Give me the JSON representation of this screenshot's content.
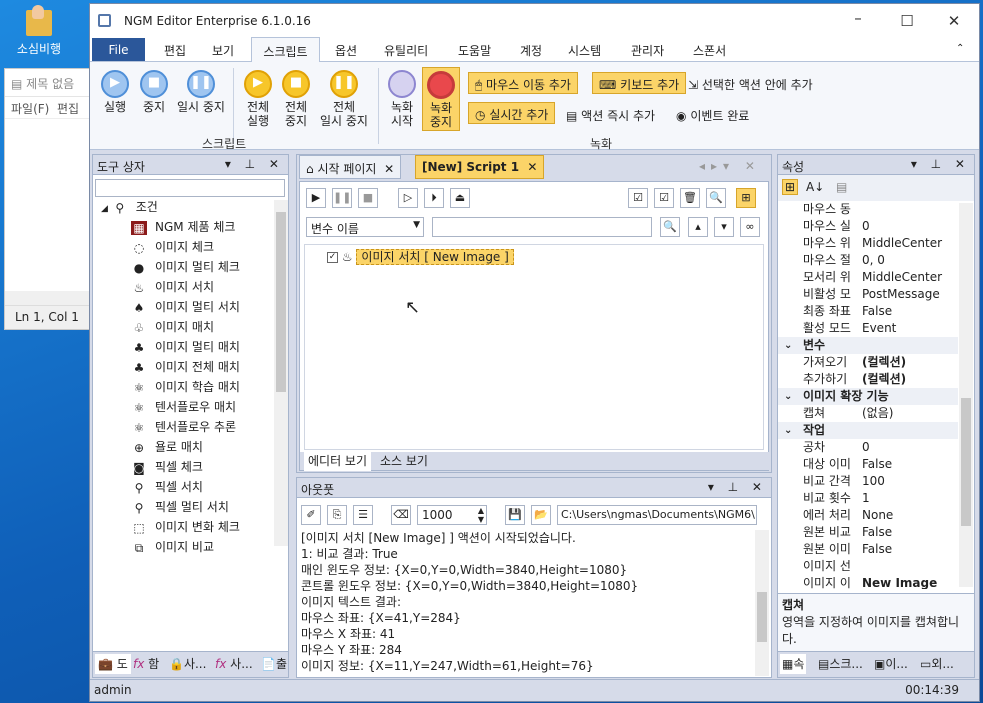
{
  "desktop": {
    "icon_label": "소심비행"
  },
  "bg_window": {
    "title": "제목 없음",
    "menu_file": "파일(F)",
    "menu_edit": "편집",
    "status": "Ln 1, Col 1"
  },
  "app": {
    "title": "NGM Editor   Enterprise 6.1.0.16",
    "menus": [
      "File",
      "편집",
      "보기",
      "스크립트",
      "옵션",
      "유틸리티",
      "도움말",
      "계정",
      "시스템",
      "관리자",
      "스폰서"
    ],
    "ribbon": {
      "run": "실행",
      "stop": "중지",
      "pause": "일시 중지",
      "run_all": [
        "전체",
        "실행"
      ],
      "stop_all": [
        "전체",
        "중지"
      ],
      "pause_all": [
        "전체",
        "일시 중지"
      ],
      "rec_start": [
        "녹화",
        "시작"
      ],
      "rec_stop": [
        "녹화",
        "중지"
      ],
      "add_mouse": "마우스 이동 추가",
      "add_key": "키보드 추가",
      "add_in_selected": "선택한 액션 안에 추가",
      "add_realtime": "실시간 추가",
      "add_action_now": "액션 즉시 추가",
      "event_done": "이벤트 완료",
      "group_script": "스크립트",
      "group_record": "녹화"
    },
    "toolbox": {
      "title": "도구 상자",
      "root": "조건",
      "items": [
        {
          "label": "NGM 제품 체크",
          "icon": "ngm-icon"
        },
        {
          "label": "이미지 체크",
          "icon": "drop-outline-icon"
        },
        {
          "label": "이미지 멀티 체크",
          "icon": "drop-filled-icon"
        },
        {
          "label": "이미지 서치",
          "icon": "flame-outline-icon"
        },
        {
          "label": "이미지 멀티 서치",
          "icon": "flame-filled-icon"
        },
        {
          "label": "이미지 매치",
          "icon": "flames-outline-icon"
        },
        {
          "label": "이미지 멀티 매치",
          "icon": "flames-filled-icon"
        },
        {
          "label": "이미지 전체 매치",
          "icon": "flames-all-icon"
        },
        {
          "label": "이미지 학습 매치",
          "icon": "atom-icon"
        },
        {
          "label": "텐서플로우 매치",
          "icon": "atom-icon"
        },
        {
          "label": "텐서플로우 추론",
          "icon": "atom-icon"
        },
        {
          "label": "욜로 매치",
          "icon": "target-icon"
        },
        {
          "label": "픽셀 체크",
          "icon": "camera-icon"
        },
        {
          "label": "픽셀 서치",
          "icon": "magnifier-icon"
        },
        {
          "label": "픽셀 멀티 서치",
          "icon": "magnifier-icon"
        },
        {
          "label": "이미지 변화 체크",
          "icon": "dashed-frame-icon"
        },
        {
          "label": "이미지 비교",
          "icon": "compare-icon"
        }
      ],
      "bottom_tabs": [
        "도",
        "함",
        "사...",
        "사...",
        "출"
      ]
    },
    "editor": {
      "tab_start": "시작 페이지",
      "tab_script": "[New] Script 1",
      "var_select": "변수 이름",
      "node_label": "이미지 서치 [ New Image ]",
      "view_editor": "에디터 보기",
      "view_source": "소스 보기"
    },
    "output": {
      "title": "아웃풋",
      "count": "1000",
      "path": "C:\\Users\\ngmas\\Documents\\NGM6\\",
      "lines": [
        "[이미지 서치 [New Image] ] 액션이 시작되었습니다.",
        "1: 비교 결과: True",
        "매인 윈도우 정보: {X=0,Y=0,Width=3840,Height=1080}",
        "콘트롤 윈도우 정보: {X=0,Y=0,Width=3840,Height=1080}",
        "이미지 텍스트 결과:",
        "마우스 좌표: {X=41,Y=284}",
        "마우스 X 좌표: 41",
        "마우스 Y 좌표: 284",
        "이미지 정보: {X=11,Y=247,Width=61,Height=76}"
      ]
    },
    "properties": {
      "title": "속성",
      "rows": [
        {
          "k": "마우스 동",
          "v": ""
        },
        {
          "k": "마우스 실",
          "v": "0"
        },
        {
          "k": "마우스 위",
          "v": "MiddleCenter"
        },
        {
          "k": "마우스 절",
          "v": "0, 0"
        },
        {
          "k": "모서리 위",
          "v": "MiddleCenter"
        },
        {
          "k": "비활성 모",
          "v": "PostMessage"
        },
        {
          "k": "최종 좌표",
          "v": "False"
        },
        {
          "k": "활성 모드",
          "v": "Event"
        },
        {
          "k": "변수",
          "v": "",
          "cat": true
        },
        {
          "k": "가져오기",
          "v": "(컬렉션)",
          "bold": true
        },
        {
          "k": "추가하기",
          "v": "(컬렉션)",
          "bold": true
        },
        {
          "k": "이미지 확장 기능",
          "v": "",
          "cat": true
        },
        {
          "k": "캡쳐",
          "v": "(없음)"
        },
        {
          "k": "작업",
          "v": "",
          "cat": true
        },
        {
          "k": "공차",
          "v": "0"
        },
        {
          "k": "대상 이미",
          "v": "False"
        },
        {
          "k": "비교 간격",
          "v": "100"
        },
        {
          "k": "비교 횟수",
          "v": "1"
        },
        {
          "k": "에러 처리",
          "v": "None"
        },
        {
          "k": "원본 비교",
          "v": "False"
        },
        {
          "k": "원본 이미",
          "v": "False"
        },
        {
          "k": "이미지 선",
          "v": ""
        },
        {
          "k": "이미지 이",
          "v": "New Image",
          "bold": true
        }
      ],
      "desc_title": "캡쳐",
      "desc_text": "영역을 지정하여 이미지를 캡쳐합니다.",
      "bottom_tabs": [
        "속",
        "스크...",
        "이...",
        "외..."
      ]
    },
    "status": {
      "user": "admin",
      "time": "00:14:39"
    }
  }
}
